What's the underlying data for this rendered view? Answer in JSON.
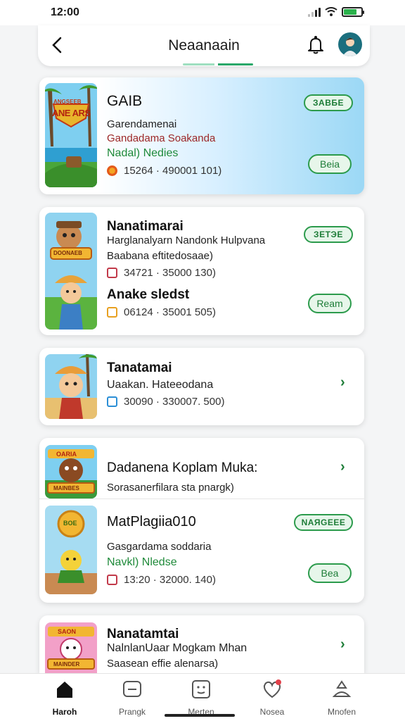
{
  "status_bar": {
    "time": "12:00",
    "battery_level": 0.75,
    "signal_icon": "signal-icon",
    "wifi_icon": "wifi-icon"
  },
  "header": {
    "title": "Neaanaain",
    "back_icon": "chevron-left-icon",
    "bell_icon": "bell-icon",
    "avatar_icon": "user-avatar"
  },
  "colors": {
    "accent": "#2c9b4c",
    "accent_light": "#e6f6ea",
    "hero_sky": "#9bd8f5"
  },
  "cards": [
    {
      "title": "GAIB",
      "lines": [
        "Garendamenai",
        "Gandadama Soakanda",
        "Nadal) Nedies"
      ],
      "meta": "15264 · 490001 101)",
      "badge": "ЗАВБЕ",
      "action": "Beia",
      "thumb_text": [
        "ANGSEEB",
        "ANE ARS"
      ]
    },
    {
      "title": "Nanatimarai",
      "lines": [
        "Harglanalyarn Nandonk Hulpvana",
        "Baabana eftitedosaae)"
      ],
      "meta": "34721 · 35000 130)",
      "badge": "ЗЕТЭЕ",
      "action": "Ream",
      "thumb_text": [
        "DOONAEB"
      ]
    },
    {
      "title": "Anake sledst",
      "meta": "06124 · 35001 505)",
      "action": "Ream"
    },
    {
      "title": "Tanatamai",
      "lines": [
        "Uaakan. Hateeodana"
      ],
      "meta": "30090 · 330007. 500)"
    },
    {
      "title": "Dadanena Koplam Muka:",
      "lines": [
        "Sorasanerfilara sta pnargk)"
      ],
      "thumb_text": [
        "OARIA",
        "MAINBES"
      ]
    },
    {
      "title": "MatPlagiia010",
      "lines": [
        "Gasgardama soddaria",
        "Navkl) Nledse"
      ],
      "meta": "13:20 · 32000. 140)",
      "badge": "NAЯGEEE",
      "action": "Bea",
      "thumb_text": [
        "BOE"
      ]
    },
    {
      "title": "Nanatamtai",
      "lines": [
        "NalnlanUaar Mogkam Mhan",
        "Saasean effie alenarsa)"
      ],
      "thumb_text": [
        "SAON",
        "MAINDER"
      ]
    }
  ],
  "tabs": [
    {
      "label": "Haroh",
      "icon": "home-icon"
    },
    {
      "label": "Prangk",
      "icon": "chat-icon"
    },
    {
      "label": "Merten",
      "icon": "face-icon"
    },
    {
      "label": "Nosea",
      "icon": "heart-notification-icon"
    },
    {
      "label": "Mnofen",
      "icon": "profile-icon"
    }
  ]
}
